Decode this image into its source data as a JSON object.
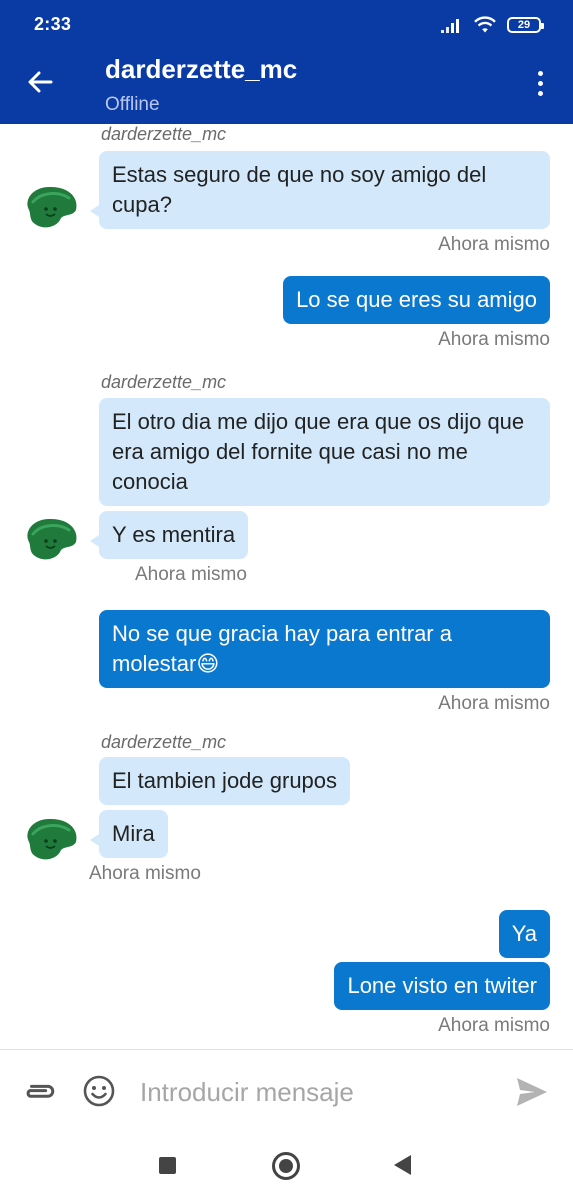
{
  "status_bar": {
    "time": "2:33",
    "battery": "29",
    "icons": [
      "signal-icon",
      "wifi-icon",
      "battery-icon"
    ]
  },
  "app_bar": {
    "title": "darderzette_mc",
    "subtitle": "Offline",
    "back_icon": "arrow-left-icon",
    "menu_icon": "more-vertical-icon",
    "background": "#0a3aa3"
  },
  "messages": [
    {
      "direction": "incoming",
      "sender": "darderzette_mc",
      "text": "Estas seguro de que no soy amigo del cupa?",
      "time": "Ahora mismo"
    },
    {
      "direction": "outgoing",
      "text": "Lo se que eres su amigo",
      "time": "Ahora mismo"
    },
    {
      "direction": "incoming",
      "sender": "darderzette_mc",
      "text": "El otro dia me dijo que era que os dijo que era amigo del fornite que casi no me conocia",
      "time": ""
    },
    {
      "direction": "incoming",
      "text": "Y es mentira",
      "time": "Ahora mismo"
    },
    {
      "direction": "outgoing",
      "text": "No se que gracia hay para entrar a molestar😄",
      "time": "Ahora mismo"
    },
    {
      "direction": "incoming",
      "sender": "darderzette_mc",
      "text": "El tambien jode grupos",
      "time": ""
    },
    {
      "direction": "incoming",
      "text": "Mira",
      "time": "Ahora mismo"
    },
    {
      "direction": "outgoing",
      "text": "Ya",
      "time": ""
    },
    {
      "direction": "outgoing",
      "text": "Lone visto en twiter",
      "time": "Ahora mismo"
    }
  ],
  "composer": {
    "placeholder": "Introducir mensaje",
    "value": "",
    "icons": [
      "paperclip-icon",
      "emoji-icon",
      "send-icon"
    ]
  },
  "colors": {
    "incoming_bubble": "#d3e9fb",
    "outgoing_bubble": "#0b78cf",
    "avatar": "#1f7a3c"
  },
  "nav_bar": {
    "icons": [
      "recent-apps-icon",
      "home-icon",
      "back-icon"
    ]
  }
}
